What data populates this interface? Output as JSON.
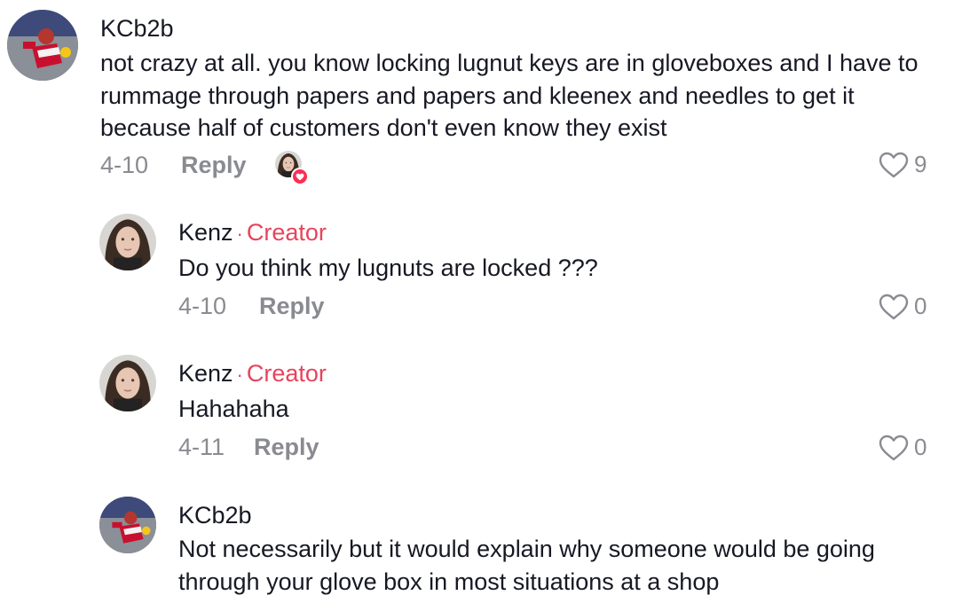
{
  "comments": [
    {
      "username": "KCb2b",
      "text": "not crazy at all. you know locking lugnut keys are in gloveboxes and I have to rummage through papers and papers and kleenex and needles to get it because half of customers don't even know they exist",
      "date": "4-10",
      "reply_label": "Reply",
      "likes": "9",
      "liked_by_creator": true
    },
    {
      "username": "Kenz",
      "badge": "Creator",
      "separator": "·",
      "text": "Do you think my lugnuts are locked ???",
      "date": "4-10",
      "reply_label": "Reply",
      "likes": "0"
    },
    {
      "username": "Kenz",
      "badge": "Creator",
      "separator": "·",
      "text": "Hahahaha",
      "date": "4-11",
      "reply_label": "Reply",
      "likes": "0"
    },
    {
      "username": "KCb2b",
      "text": "Not necessarily but it would explain why someone would be going through your glove box in most situations at a shop"
    }
  ]
}
